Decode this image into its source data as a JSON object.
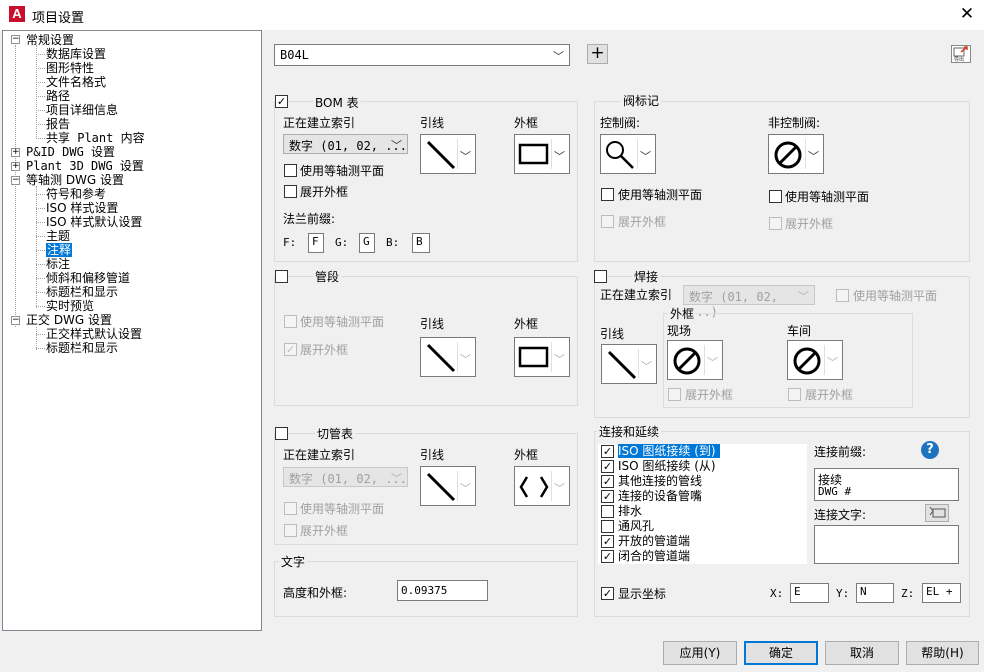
{
  "window": {
    "title": "项目设置",
    "app_icon": "A",
    "close_glyph": "✕"
  },
  "tree": {
    "general": {
      "label": "常规设置",
      "children": [
        "数据库设置",
        "图形特性",
        "文件名格式",
        "路径",
        "项目详细信息",
        "报告",
        "共享 Plant 内容"
      ]
    },
    "pid": {
      "label": "P&ID DWG 设置"
    },
    "plant3d": {
      "label": "Plant 3D DWG 设置"
    },
    "iso": {
      "label": "等轴测 DWG 设置",
      "children": [
        "符号和参考",
        "ISO 样式设置",
        "ISO 样式默认设置",
        "主题",
        "注释",
        "标注",
        "倾斜和偏移管道",
        "标题栏和显示",
        "实时预览"
      ],
      "selected": "注释"
    },
    "ortho": {
      "label": "正交 DWG 设置",
      "children": [
        "正交样式默认设置",
        "标题栏和显示"
      ]
    },
    "expand_glyphs": {
      "minus": "−",
      "plus": "+"
    }
  },
  "style_select": {
    "value": "B04L",
    "add_glyph": "+",
    "export_label": "导出"
  },
  "bom": {
    "label": "BOM 表",
    "checked": true,
    "index_label": "正在建立索引",
    "index_value": "数字 (01, 02, ...",
    "leader_label": "引线",
    "frame_label": "外框",
    "iso_plane": "使用等轴测平面",
    "expand_frame": "展开外框",
    "flange_label": "法兰前缀:",
    "f_label": "F:",
    "f_value": "F",
    "g_label": "G:",
    "g_value": "G",
    "b_label": "B:",
    "b_value": "B"
  },
  "valve": {
    "label": "阀标记",
    "control": "控制阀:",
    "noncontrol": "非控制阀:",
    "iso_plane": "使用等轴测平面",
    "expand_frame": "展开外框"
  },
  "segment": {
    "label": "管段",
    "iso_plane": "使用等轴测平面",
    "expand_frame": "展开外框",
    "leader_label": "引线",
    "frame_label": "外框"
  },
  "weld": {
    "label": "焊接",
    "index_label": "正在建立索引",
    "index_value": "数字 (01, 02, ...)",
    "iso_plane": "使用等轴测平面",
    "leader_label": "引线",
    "frame_label": "外框",
    "field": "现场",
    "shop": "车间",
    "expand_frame": "展开外框"
  },
  "cut": {
    "label": "切管表",
    "index_label": "正在建立索引",
    "index_value": "数字 (01, 02, ...",
    "leader_label": "引线",
    "frame_label": "外框",
    "iso_plane": "使用等轴测平面",
    "expand_frame": "展开外框"
  },
  "connections": {
    "label": "连接和延续",
    "items": [
      {
        "label": "ISO 图纸接续 (到)",
        "checked": true
      },
      {
        "label": "ISO 图纸接续 (从)",
        "checked": true
      },
      {
        "label": "其他连接的管线",
        "checked": true
      },
      {
        "label": "连接的设备管嘴",
        "checked": true
      },
      {
        "label": "排水",
        "checked": false
      },
      {
        "label": "通风孔",
        "checked": false
      },
      {
        "label": "开放的管道端",
        "checked": true
      },
      {
        "label": "闭合的管道端",
        "checked": true
      }
    ],
    "prefix_label": "连接前缀:",
    "prefix_lines": [
      "接续",
      "DWG #"
    ],
    "text_label": "连接文字:",
    "show_coords": "显示坐标",
    "x_label": "X:",
    "x_value": "E",
    "y_label": "Y:",
    "y_value": "N",
    "z_label": "Z:",
    "z_value": "EL +"
  },
  "text": {
    "label": "文字",
    "height_label": "高度和外框:",
    "height_value": "0.09375"
  },
  "buttons": {
    "apply": "应用(Y)",
    "ok": "确定",
    "cancel": "取消",
    "help": "帮助(H)"
  },
  "colors": {
    "selection": "#0078d7",
    "help_icon": "#1e73be",
    "app_icon": "#c8102e"
  }
}
